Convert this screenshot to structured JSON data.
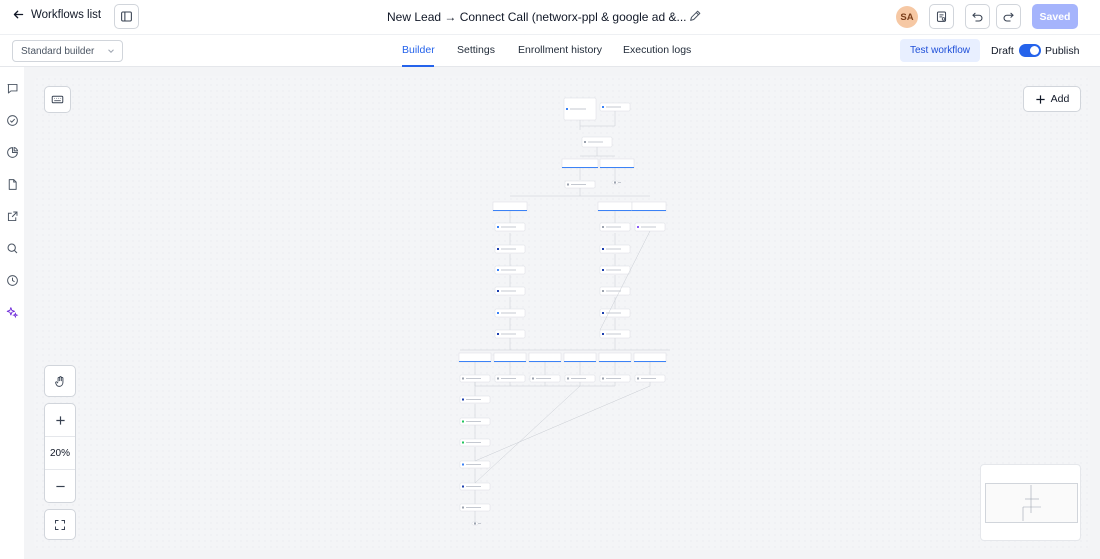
{
  "header": {
    "back_label": "Workflows list",
    "title": "New Lead → Connect Call (networx-ppl & google ad &...",
    "avatar_initials": "SA",
    "saved_label": "Saved"
  },
  "subbar": {
    "builder_select": "Standard builder",
    "tabs": [
      {
        "label": "Builder",
        "active": true
      },
      {
        "label": "Settings",
        "active": false
      },
      {
        "label": "Enrollment history",
        "active": false
      },
      {
        "label": "Execution logs",
        "active": false
      }
    ],
    "test_workflow_label": "Test workflow",
    "draft_label": "Draft",
    "publish_label": "Publish"
  },
  "left_rail": {
    "icons": [
      "chat-icon",
      "check-circle-icon",
      "pie-chart-icon",
      "file-icon",
      "external-link-icon",
      "search-icon",
      "history-icon",
      "sparkle-icon"
    ]
  },
  "canvas": {
    "add_label": "Add",
    "zoom_level": "20%"
  },
  "colors": {
    "accent": "#2563eb",
    "saved_bg": "#a5b4fc",
    "test_bg": "#e8efff"
  }
}
